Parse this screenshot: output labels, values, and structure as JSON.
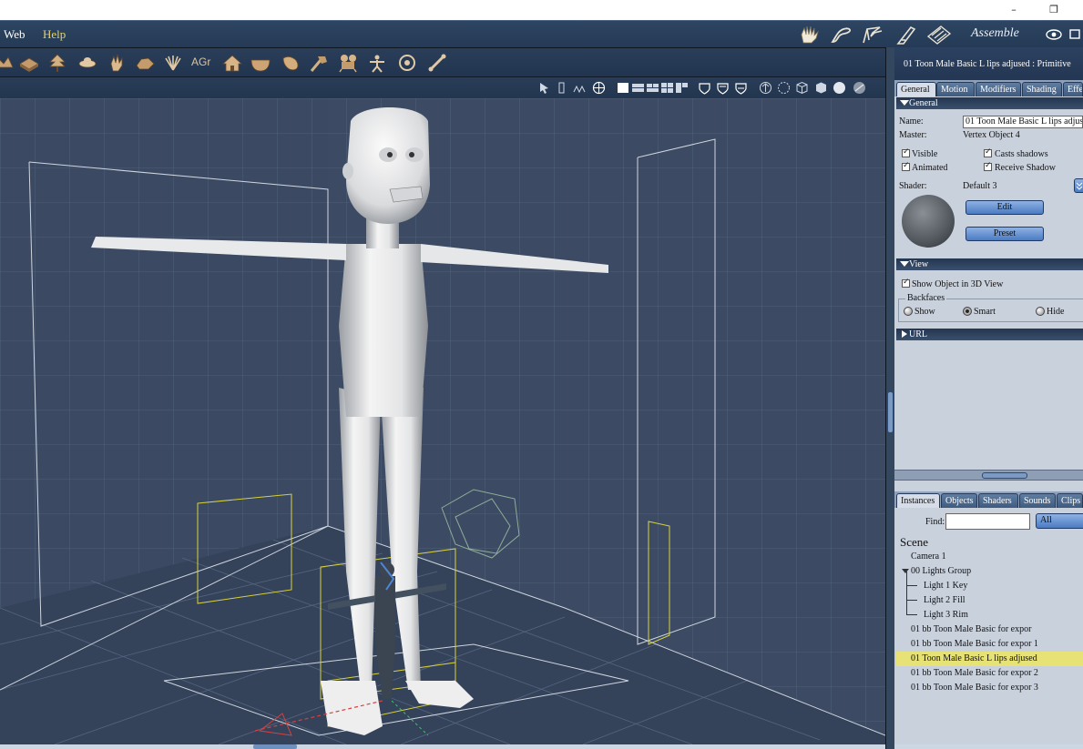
{
  "window": {
    "minimize_glyph": "–",
    "restore_glyph": "❐"
  },
  "menubar": {
    "items": [
      "Web",
      "Help"
    ],
    "room_label": "Assemble",
    "room_tab_icons": [
      "hand-icon",
      "brush-icon",
      "pen-icon",
      "ruler-icon",
      "film-icon"
    ]
  },
  "toolbar": {
    "icons": [
      "terrain-icon",
      "plane-icon",
      "tree-icon",
      "cloud-icon",
      "hand-icon",
      "rock-icon",
      "plant-icon",
      "agr-icon",
      "house-icon",
      "bowl-icon",
      "leaf-icon",
      "hammer-icon",
      "camera-icon",
      "figure-icon",
      "target-icon",
      "bone-icon"
    ],
    "agr_text": "AGr"
  },
  "properties": {
    "title": "01 Toon Male Basic L lips adjused : Primitive",
    "tabs": [
      "General",
      "Motion",
      "Modifiers",
      "Shading",
      "Effe"
    ],
    "general_header": "General",
    "name_label": "Name:",
    "name_value": "01 Toon Male Basic L lips adjus",
    "master_label": "Master:",
    "master_value": "Vertex Object 4",
    "visible_label": "Visible",
    "casts_shadows_label": "Casts shadows",
    "animated_label": "Animated",
    "receive_shadow_label": "Receive Shadow",
    "shader_label": "Shader:",
    "shader_value": "Default 3",
    "edit_label": "Edit",
    "preset_label": "Preset",
    "view_header": "View",
    "show_object_label": "Show Object in 3D View",
    "backfaces_label": "Backfaces",
    "backfaces_options": [
      "Show",
      "Smart",
      "Hide"
    ],
    "url_header": "URL"
  },
  "scene_panel": {
    "tabs": [
      "Instances",
      "Objects",
      "Shaders",
      "Sounds",
      "Clips"
    ],
    "find_label": "Find:",
    "find_value": "",
    "filter_value": "All",
    "scene_header": "Scene",
    "items": [
      {
        "label": "Camera 1",
        "indent": 0
      },
      {
        "label": "00 Lights Group",
        "indent": 0,
        "group": true
      },
      {
        "label": "Light 1 Key",
        "indent": 1
      },
      {
        "label": "Light 2 Fill",
        "indent": 1
      },
      {
        "label": "Light 3 Rim",
        "indent": 1
      },
      {
        "label": "01 bb Toon Male Basic for expor",
        "indent": 0
      },
      {
        "label": "01 bb Toon Male Basic for expor 1",
        "indent": 0
      },
      {
        "label": "01 Toon Male Basic L lips adjused",
        "indent": 0,
        "selected": true
      },
      {
        "label": "01 bb Toon Male Basic for expor 2",
        "indent": 0
      },
      {
        "label": "01 bb Toon Male Basic for expor 3",
        "indent": 0
      }
    ]
  },
  "colors": {
    "selection": "#e7e276",
    "viewport_bg": "#3a4961",
    "menu_text_active": "#e7d26a"
  }
}
